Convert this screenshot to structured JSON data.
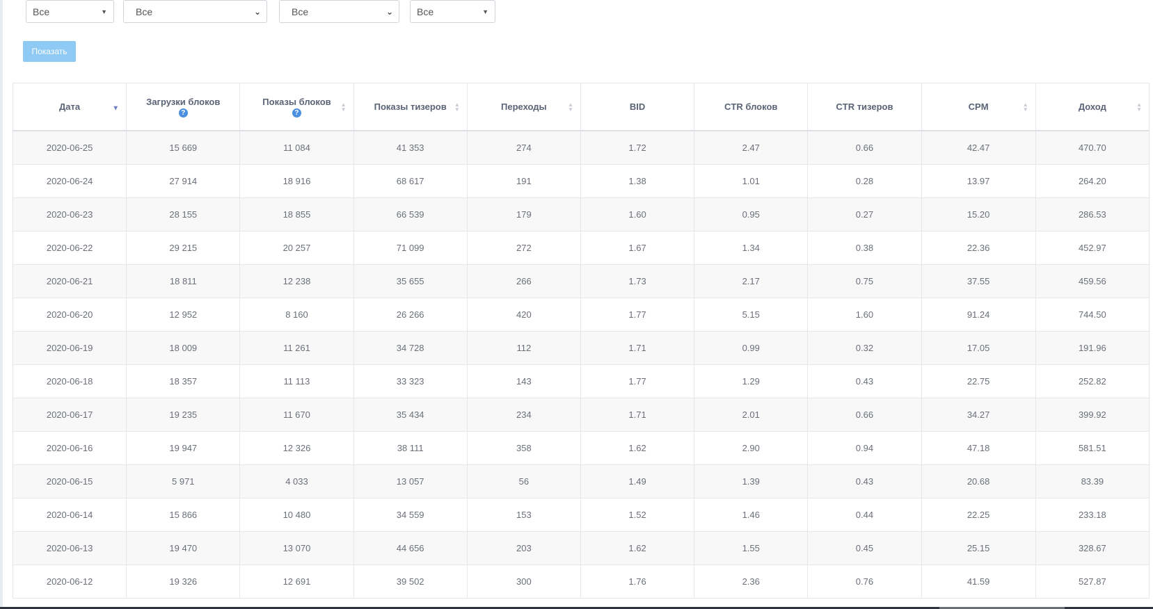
{
  "filters": [
    {
      "value": "Все",
      "caret": "▼"
    },
    {
      "value": "Все",
      "caret": "⌄"
    },
    {
      "value": "Все",
      "caret": "⌄"
    },
    {
      "value": "Все",
      "caret": "▼"
    }
  ],
  "show_button": "Показать",
  "table": {
    "columns": [
      {
        "label": "Дата"
      },
      {
        "label": "Загрузки блоков",
        "help": "?"
      },
      {
        "label": "Показы блоков",
        "help": "?"
      },
      {
        "label": "Показы тизеров"
      },
      {
        "label": "Переходы"
      },
      {
        "label": "BID"
      },
      {
        "label": "CTR блоков"
      },
      {
        "label": "CTR тизеров"
      },
      {
        "label": "CPM"
      },
      {
        "label": "Доход"
      }
    ],
    "sort_active_glyph": "▼",
    "sort_glyph_up": "▲",
    "sort_glyph_down": "▼",
    "rows": [
      [
        "2020-06-25",
        "15 669",
        "11 084",
        "41 353",
        "274",
        "1.72",
        "2.47",
        "0.66",
        "42.47",
        "470.70"
      ],
      [
        "2020-06-24",
        "27 914",
        "18 916",
        "68 617",
        "191",
        "1.38",
        "1.01",
        "0.28",
        "13.97",
        "264.20"
      ],
      [
        "2020-06-23",
        "28 155",
        "18 855",
        "66 539",
        "179",
        "1.60",
        "0.95",
        "0.27",
        "15.20",
        "286.53"
      ],
      [
        "2020-06-22",
        "29 215",
        "20 257",
        "71 099",
        "272",
        "1.67",
        "1.34",
        "0.38",
        "22.36",
        "452.97"
      ],
      [
        "2020-06-21",
        "18 811",
        "12 238",
        "35 655",
        "266",
        "1.73",
        "2.17",
        "0.75",
        "37.55",
        "459.56"
      ],
      [
        "2020-06-20",
        "12 952",
        "8 160",
        "26 266",
        "420",
        "1.77",
        "5.15",
        "1.60",
        "91.24",
        "744.50"
      ],
      [
        "2020-06-19",
        "18 009",
        "11 261",
        "34 728",
        "112",
        "1.71",
        "0.99",
        "0.32",
        "17.05",
        "191.96"
      ],
      [
        "2020-06-18",
        "18 357",
        "11 113",
        "33 323",
        "143",
        "1.77",
        "1.29",
        "0.43",
        "22.75",
        "252.82"
      ],
      [
        "2020-06-17",
        "19 235",
        "11 670",
        "35 434",
        "234",
        "1.71",
        "2.01",
        "0.66",
        "34.27",
        "399.92"
      ],
      [
        "2020-06-16",
        "19 947",
        "12 326",
        "38 111",
        "358",
        "1.62",
        "2.90",
        "0.94",
        "47.18",
        "581.51"
      ],
      [
        "2020-06-15",
        "5 971",
        "4 033",
        "13 057",
        "56",
        "1.49",
        "1.39",
        "0.43",
        "20.68",
        "83.39"
      ],
      [
        "2020-06-14",
        "15 866",
        "10 480",
        "34 559",
        "153",
        "1.52",
        "1.46",
        "0.44",
        "22.25",
        "233.18"
      ],
      [
        "2020-06-13",
        "19 470",
        "13 070",
        "44 656",
        "203",
        "1.62",
        "1.55",
        "0.45",
        "25.15",
        "328.67"
      ],
      [
        "2020-06-12",
        "19 326",
        "12 691",
        "39 502",
        "300",
        "1.76",
        "2.36",
        "0.76",
        "41.59",
        "527.87"
      ]
    ]
  }
}
